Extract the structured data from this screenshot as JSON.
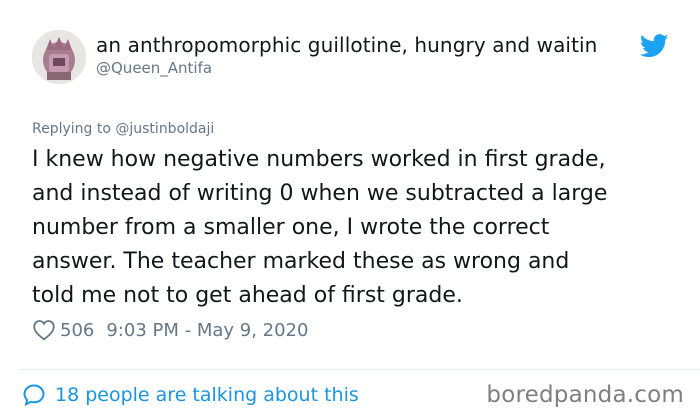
{
  "tweet": {
    "author": {
      "display_name": "an anthropomorphic guillotine, hungry and waitin",
      "handle": "@Queen_Antifa",
      "avatar_icon": "avatar"
    },
    "platform_icon": "twitter-bird-icon",
    "reply_to": "Replying to @justinboldaji",
    "text": "I knew how negative numbers worked in first grade,\nand instead of writing 0 when we subtracted a large\nnumber from a smaller one, I wrote the correct\nanswer.  The teacher marked these as wrong and\ntold me not to get ahead of first grade.",
    "likes": "506",
    "timestamp": "9:03 PM - May 9, 2020",
    "talking_about": "18 people are talking about this"
  },
  "watermark": "boredpanda.com",
  "colors": {
    "twitter_blue": "#1da1f2",
    "link_blue": "#1b95e0",
    "muted_gray": "#657786",
    "text_dark": "#14171a"
  }
}
